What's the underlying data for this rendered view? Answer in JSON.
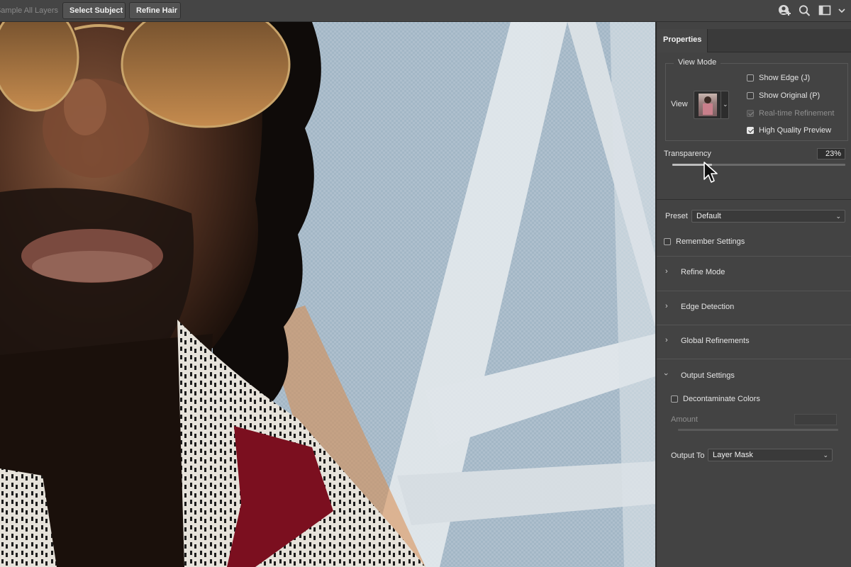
{
  "topbar": {
    "sample_all_layers": "Sample All Layers",
    "select_subject": "Select Subject",
    "refine_hair": "Refine Hair",
    "icons": [
      "user-plus-icon",
      "search-icon",
      "workspace-icon",
      "chevron-down-icon"
    ]
  },
  "panel": {
    "tab": "Properties",
    "view_mode": {
      "legend": "View Mode",
      "view_label": "View",
      "show_edge": "Show Edge (J)",
      "show_original": "Show Original (P)",
      "realtime_refinement": "Real-time Refinement",
      "high_quality_preview": "High Quality Preview",
      "show_edge_checked": false,
      "show_original_checked": false,
      "realtime_refinement_checked": true,
      "high_quality_preview_checked": true
    },
    "transparency": {
      "label": "Transparency",
      "value": "23%",
      "fraction": 0.23
    },
    "preset": {
      "label": "Preset",
      "value": "Default"
    },
    "remember_settings": {
      "label": "Remember Settings",
      "checked": false
    },
    "sections": [
      {
        "title": "Refine Mode",
        "expanded": false
      },
      {
        "title": "Edge Detection",
        "expanded": false
      },
      {
        "title": "Global Refinements",
        "expanded": false
      },
      {
        "title": "Output Settings",
        "expanded": true
      }
    ],
    "output": {
      "decontaminate_label": "Decontaminate Colors",
      "decontaminate_checked": false,
      "amount_label": "Amount",
      "amount_value": "",
      "output_to_label": "Output To",
      "output_to_value": "Layer Mask"
    }
  },
  "colors": {
    "panel_bg": "#434343",
    "topbar_bg": "#454545",
    "sky": "#a9c1d2"
  }
}
